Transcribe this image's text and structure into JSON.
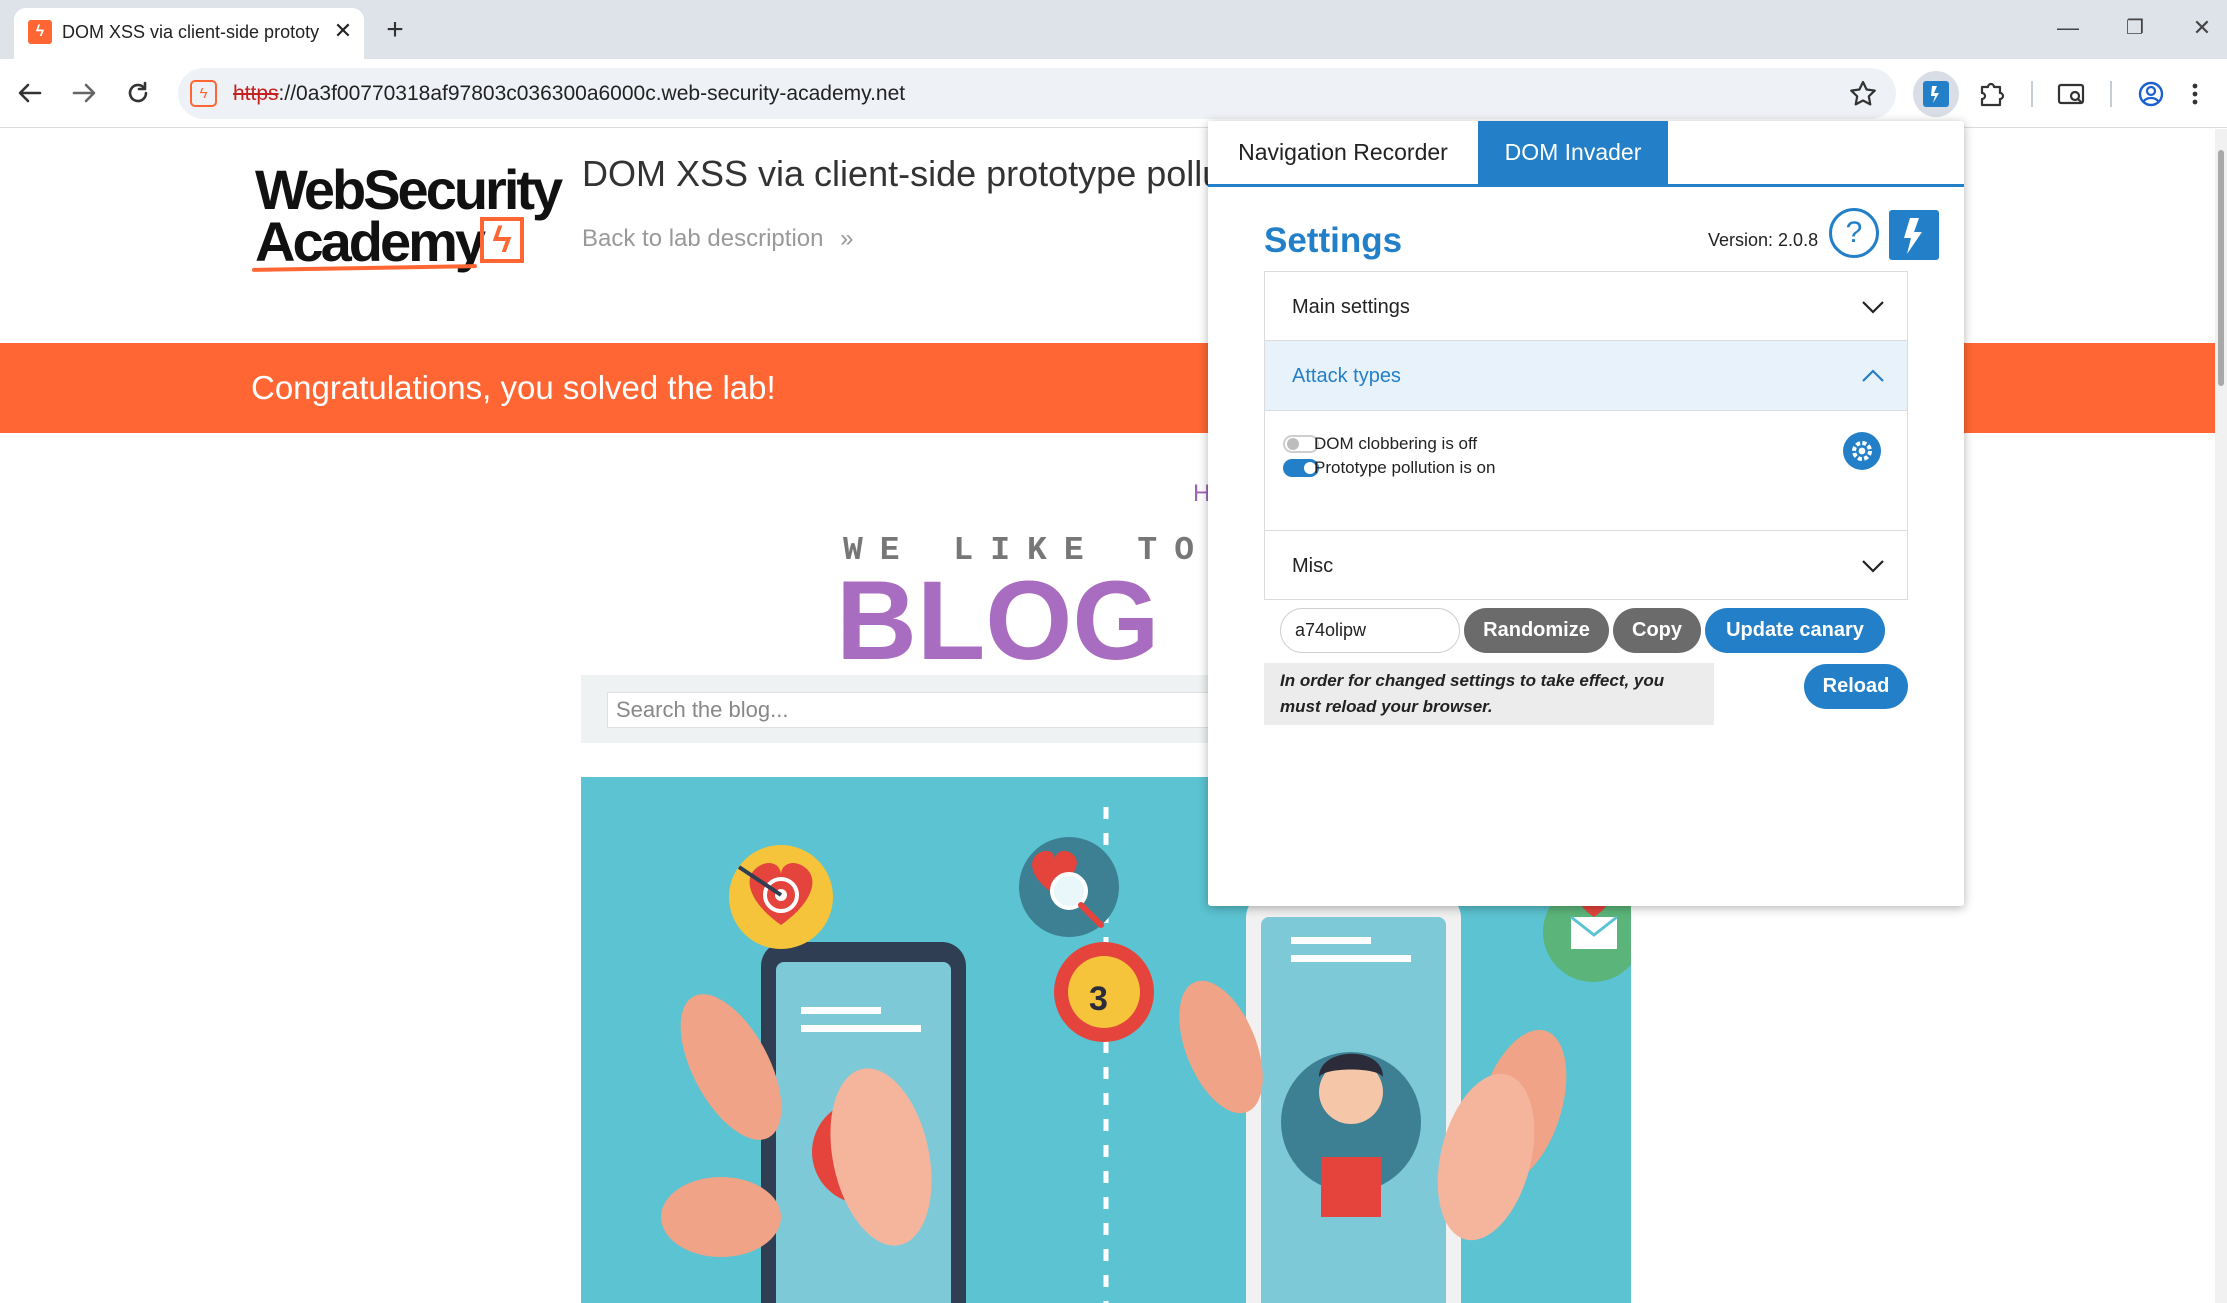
{
  "browser": {
    "tab_title": "DOM XSS via client-side prototy",
    "tab_close": "✕",
    "new_tab": "+",
    "url_scheme": "https",
    "url_rest": "://0a3f00770318af97803c036300a6000c.web-security-academy.net",
    "window_controls": {
      "minimize": "—",
      "restore": "❐",
      "close": "✕"
    }
  },
  "page": {
    "logo": {
      "line1": "WebSecurity",
      "line2": "Academy",
      "mark": "ϟ"
    },
    "lab_title": "DOM XSS via client-side prototype pollution",
    "back_link": "Back to lab description",
    "back_link_arrow": "»",
    "banner": "Congratulations, you solved the lab!",
    "nav_home": "H",
    "tagline": "WE LIKE TO",
    "blog_word": "BLOG",
    "search_placeholder": "Search the blog..."
  },
  "dom_invader": {
    "tabs": [
      "Navigation Recorder",
      "DOM Invader"
    ],
    "active_tab": "DOM Invader",
    "settings_title": "Settings",
    "version": "Version: 2.0.8",
    "help": "?",
    "sections": {
      "main": "Main settings",
      "attack": "Attack types",
      "misc": "Misc"
    },
    "options": [
      {
        "label": "DOM clobbering is off",
        "on": false
      },
      {
        "label": "Prototype pollution is on",
        "on": true
      }
    ],
    "canary_value": "a74olipw",
    "buttons": {
      "randomize": "Randomize",
      "copy": "Copy",
      "update": "Update canary",
      "reload": "Reload"
    },
    "notice": "In order for changed settings to take effect, you must reload your browser."
  },
  "colors": {
    "accent_orange": "#ff6633",
    "invader_blue": "#2380c8",
    "blog_purple": "#a86cc0",
    "hero_teal": "#5bc3d1"
  },
  "icons": [
    "back-icon",
    "forward-icon",
    "reload-icon",
    "star-icon",
    "dom-invader-icon",
    "extensions-icon",
    "reading-list-icon",
    "profile-icon",
    "menu-icon",
    "settings-gear-icon",
    "help-icon"
  ]
}
